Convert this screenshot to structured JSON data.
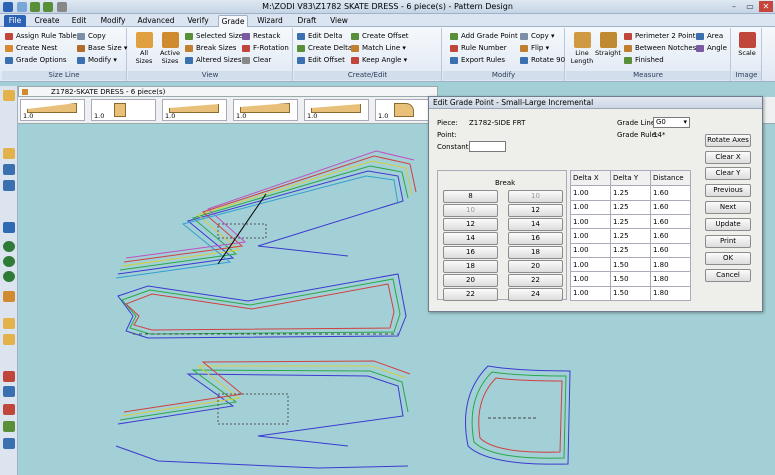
{
  "title": "M:\\ZODI V83\\Z1782 SKATE DRESS  -  6 piece(s)  - Pattern Design",
  "tabs": [
    "File",
    "Create",
    "Edit",
    "Modify",
    "Advanced",
    "Verify",
    "Grade",
    "Wizard",
    "Draft",
    "View"
  ],
  "active_tab": "Grade",
  "ribbon": {
    "size_line": {
      "title": "Size Line",
      "items": [
        "Assign Rule Table",
        "Create Nest",
        "Grade Options",
        "Copy",
        "Base Size",
        "Modify"
      ]
    },
    "view": {
      "title": "View",
      "big": [
        "All Sizes",
        "Active Sizes"
      ],
      "items": [
        "Selected Sizes",
        "Break Sizes",
        "Altered Sizes",
        "Restack",
        "F-Rotation",
        "Clear"
      ]
    },
    "create_edit": {
      "title": "Create/Edit",
      "items": [
        "Edit Delta",
        "Create Delta",
        "Edit Offset",
        "Create Offset",
        "Match Line",
        "Keep Angle"
      ]
    },
    "modify": {
      "title": "Modify",
      "items": [
        "Add Grade Point",
        "Rule Number",
        "Export Rules",
        "Copy",
        "Flip",
        "Rotate 90"
      ]
    },
    "measure": {
      "title": "Measure",
      "big": [
        "Line Length",
        "Straight"
      ],
      "items": [
        "Perimeter 2 Points",
        "Between Notches",
        "Finished",
        "Area",
        "Angle"
      ]
    },
    "image": {
      "title": "Image",
      "big": [
        "Scale"
      ]
    }
  },
  "doc_tab": "Z1782-SKATE DRESS  -  6 piece(s)",
  "thumbs": [
    "1.0",
    "1.0",
    "1.0",
    "1.0",
    "1.0",
    "1.0"
  ],
  "dialog": {
    "title": "Edit Grade Point - Small-Large Incremental",
    "piece_label": "Piece:",
    "piece_value": "Z1782-SIDE FRT",
    "point_label": "Point:",
    "constant_label": "Constant:",
    "constant_value": "",
    "grade_line_label": "Grade Line:",
    "grade_line_value": "G0",
    "grade_rule_label": "Grade Rule:",
    "grade_rule_value": "14*",
    "break_label": "Break",
    "breaks": [
      {
        "from": "8",
        "to": "10"
      },
      {
        "from": "10",
        "to": "12"
      },
      {
        "from": "12",
        "to": "14"
      },
      {
        "from": "14",
        "to": "16"
      },
      {
        "from": "16",
        "to": "18"
      },
      {
        "from": "18",
        "to": "20"
      },
      {
        "from": "20",
        "to": "22"
      },
      {
        "from": "22",
        "to": "24"
      }
    ],
    "columns": [
      "Delta X",
      "Delta Y",
      "Distance"
    ],
    "rows": [
      [
        "1.00",
        "1.25",
        "1.60"
      ],
      [
        "1.00",
        "1.25",
        "1.60"
      ],
      [
        "1.00",
        "1.25",
        "1.60"
      ],
      [
        "1.00",
        "1.25",
        "1.60"
      ],
      [
        "1.00",
        "1.25",
        "1.60"
      ],
      [
        "1.00",
        "1.50",
        "1.80"
      ],
      [
        "1.00",
        "1.50",
        "1.80"
      ],
      [
        "1.00",
        "1.50",
        "1.80"
      ]
    ],
    "buttons": [
      "Rotate Axes",
      "Clear X",
      "Clear Y",
      "Previous",
      "Next",
      "Update",
      "Print",
      "OK",
      "Cancel"
    ]
  }
}
